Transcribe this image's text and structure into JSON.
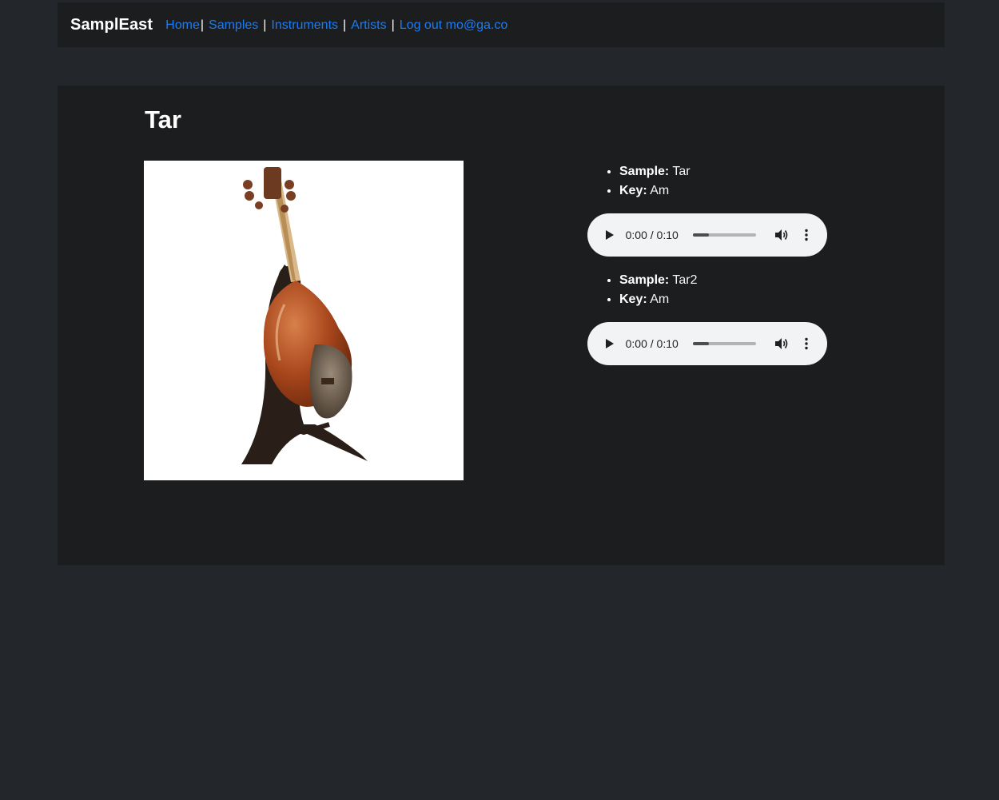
{
  "nav": {
    "brand": "SamplEast",
    "links": {
      "home": "Home",
      "samples": "Samples",
      "instruments": "Instruments",
      "artists": "Artists",
      "logout": "Log out mo@ga.co"
    },
    "separator": "|"
  },
  "instrument": {
    "name": "Tar",
    "image_icon": "tar-instrument-image"
  },
  "samples": [
    {
      "sample_label": "Sample:",
      "sample_value": "Tar",
      "key_label": "Key:",
      "key_value": "Am",
      "player": {
        "time": "0:00 / 0:10",
        "progress": 0.25
      }
    },
    {
      "sample_label": "Sample:",
      "sample_value": "Tar2",
      "key_label": "Key:",
      "key_value": "Am",
      "player": {
        "time": "0:00 / 0:10",
        "progress": 0.25
      }
    }
  ],
  "colors": {
    "page_bg": "#23272b",
    "panel_bg": "#1c1d1f",
    "link": "#1a7cf5",
    "player_bg": "#f1f3f4"
  }
}
